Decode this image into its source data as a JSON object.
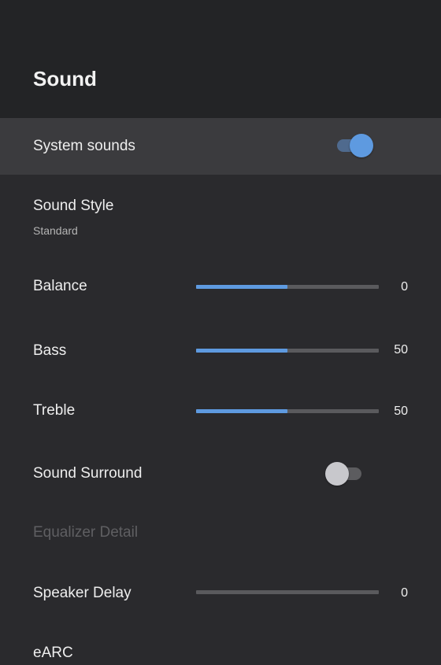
{
  "header": {
    "title": "Sound"
  },
  "settings": {
    "system_sounds": {
      "label": "System sounds",
      "enabled": true
    },
    "sound_style": {
      "label": "Sound Style",
      "value": "Standard"
    },
    "balance": {
      "label": "Balance",
      "value": "0",
      "level": 0.5
    },
    "bass": {
      "label": "Bass",
      "value": "50",
      "level": 0.5
    },
    "treble": {
      "label": "Treble",
      "value": "50",
      "level": 0.5
    },
    "sound_surround": {
      "label": "Sound Surround",
      "enabled": false
    },
    "equalizer_detail": {
      "label": "Equalizer Detail",
      "disabled": true
    },
    "speaker_delay": {
      "label": "Speaker Delay",
      "value": "0",
      "level": 0
    },
    "earc": {
      "label": "eARC"
    }
  },
  "colors": {
    "accent": "#5e9ae0",
    "background": "#2a2a2d",
    "header_background": "#232426",
    "selected_row": "#3b3b3e",
    "disabled_text": "#5f5f62"
  }
}
